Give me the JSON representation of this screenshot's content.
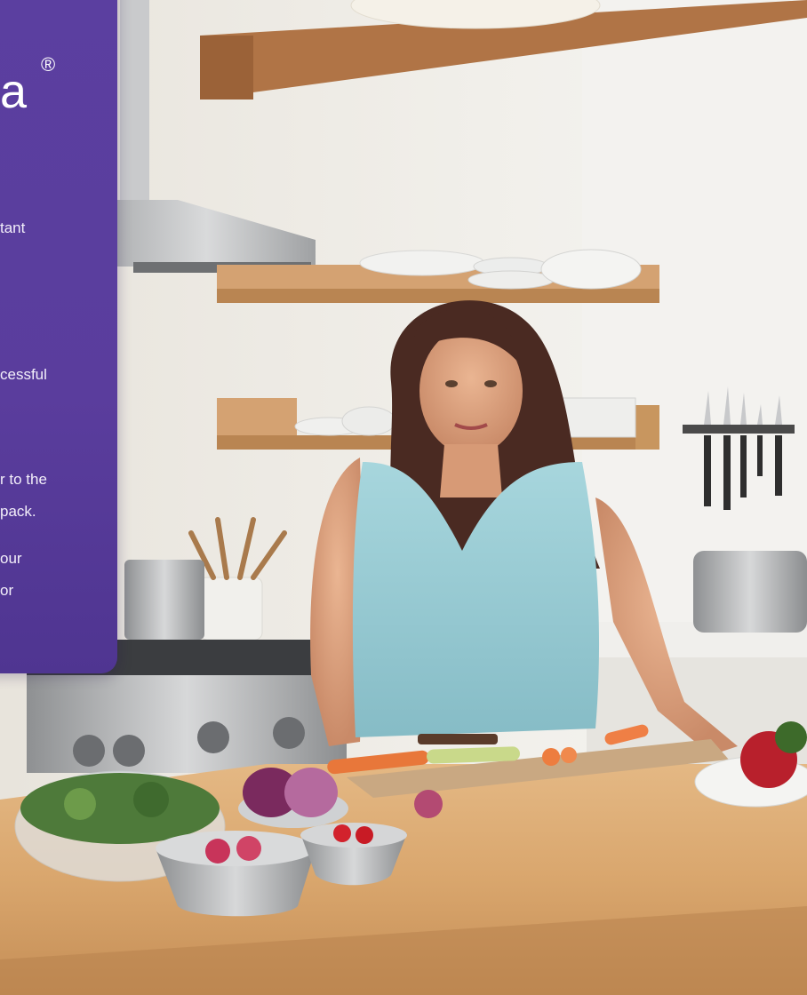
{
  "panel": {
    "brand_fragment": "a",
    "brand_mark": "®",
    "fragments": [
      "tant",
      "cessful",
      "r to the",
      "pack.",
      "our",
      "or"
    ]
  }
}
